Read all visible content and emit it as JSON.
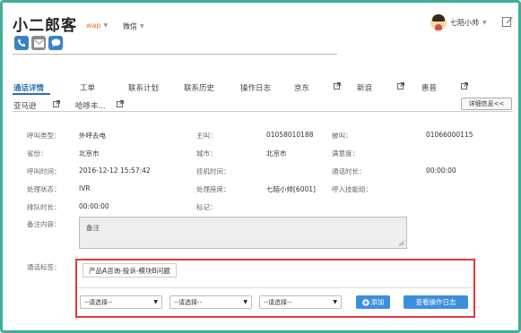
{
  "header": {
    "title": "小二郎客",
    "dropdown_wap": "wap",
    "dropdown_wechat": "微信",
    "user_name": "七陌小帅"
  },
  "icons": {
    "phone": "phone-icon",
    "mail": "mail-icon",
    "chat": "chat-icon",
    "edit": "edit-icon",
    "avatar": "avatar"
  },
  "tabs": [
    {
      "label": "通话详情",
      "active": true
    },
    {
      "label": "工单"
    },
    {
      "label": "联系计划"
    },
    {
      "label": "联系历史"
    },
    {
      "label": "操作日志"
    },
    {
      "label": "京东",
      "external": true
    },
    {
      "label": "新浪",
      "external": true
    },
    {
      "label": "惠普",
      "external": true
    },
    {
      "label": "亚马逊",
      "external": true
    },
    {
      "label": "哈哆丰...",
      "external": true
    }
  ],
  "detail_button": "详细信息<<",
  "info": {
    "call_type_label": "呼叫类型：",
    "call_type": "外呼去电",
    "caller_label": "主叫：",
    "caller": "01058010188",
    "callee_label": "被叫：",
    "callee": "01066000115",
    "province_label": "省份：",
    "province": "北京市",
    "city_label": "城市：",
    "city": "北京市",
    "satisfaction_label": "满意度：",
    "satisfaction": "",
    "call_time_label": "呼叫时间：",
    "call_time": "2016-12-12 15:57:42",
    "hangup_time_label": "挂机时间：",
    "hangup_time": "",
    "duration_label": "通话时长：",
    "duration": "00:00:00",
    "status_label": "处理状态：",
    "status": "IVR",
    "seat_label": "处理座席：",
    "seat": "七陌小帅[6001]",
    "skill_group_label": "呼入技能组：",
    "skill_group": "",
    "queue_time_label": "排队时长：",
    "queue_time": "00:00:00",
    "mark_label": "标记：",
    "mark": "",
    "remark_label": "备注内容：",
    "remark_placeholder": "备注"
  },
  "tags": {
    "label": "通话标签：",
    "selected_tag": "产品A咨询-投诉-模块B问题",
    "select_1": "--请选择--",
    "select_2": "--请选择--",
    "select_3": "--请选择--",
    "add_button": "添加",
    "log_button": "查看操作日志"
  },
  "colors": {
    "frame": "#3fae98",
    "accent_blue": "#3d8ede",
    "highlight_red": "#e03a3a",
    "wap_orange": "#e8702a"
  }
}
